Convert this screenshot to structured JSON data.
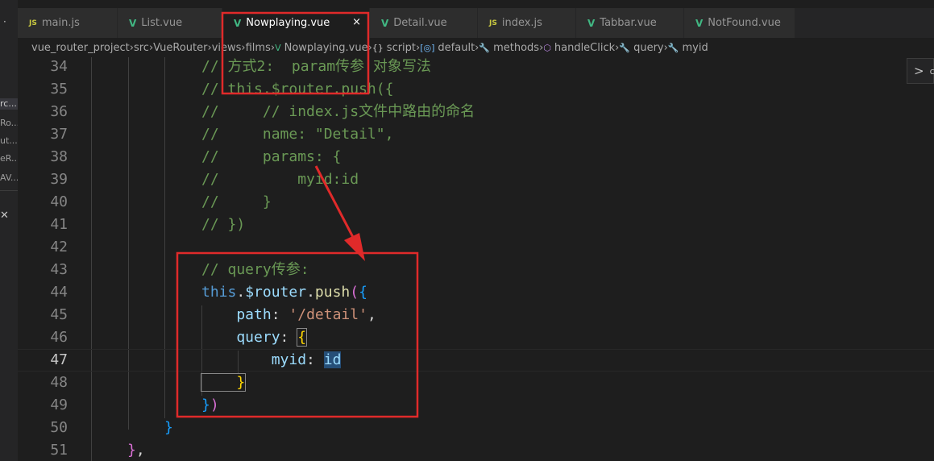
{
  "sidebar_fragment": {
    "items": [
      "rc...",
      "Ro...",
      "ut...",
      "eR...",
      "AV..."
    ]
  },
  "tabs": [
    {
      "icon": "JS",
      "label": "main.js",
      "active": false
    },
    {
      "icon": "V",
      "label": "List.vue",
      "active": false
    },
    {
      "icon": "V",
      "label": "Nowplaying.vue",
      "active": true
    },
    {
      "icon": "V",
      "label": "Detail.vue",
      "active": false
    },
    {
      "icon": "JS",
      "label": "index.js",
      "active": false
    },
    {
      "icon": "V",
      "label": "Tabbar.vue",
      "active": false
    },
    {
      "icon": "V",
      "label": "NotFound.vue",
      "active": false
    }
  ],
  "active_tab_close": "×",
  "breadcrumb": [
    "vue_router_project",
    "src",
    "VueRouter",
    "views",
    "films",
    "Nowplaying.vue",
    "script",
    "default",
    "methods",
    "handleClick",
    "query",
    "myid"
  ],
  "breadcrumb_icons": {
    "script": "{}",
    "default": "[◎]"
  },
  "editor": {
    "current_line": 47,
    "lines": [
      {
        "n": "34",
        "t": [
          [
            "c",
            "// 方式2:  param传参 对象写法"
          ]
        ]
      },
      {
        "n": "35",
        "t": [
          [
            "c",
            "// this.$router.push({"
          ]
        ]
      },
      {
        "n": "36",
        "t": [
          [
            "c",
            "//     // index.js文件中路由的命名"
          ]
        ]
      },
      {
        "n": "37",
        "t": [
          [
            "c",
            "//     name: \"Detail\","
          ]
        ]
      },
      {
        "n": "38",
        "t": [
          [
            "c",
            "//     params: {"
          ]
        ]
      },
      {
        "n": "39",
        "t": [
          [
            "c",
            "//         myid:id"
          ]
        ]
      },
      {
        "n": "40",
        "t": [
          [
            "c",
            "//     }"
          ]
        ]
      },
      {
        "n": "41",
        "t": [
          [
            "c",
            "// })"
          ]
        ]
      },
      {
        "n": "42",
        "t": []
      },
      {
        "n": "43",
        "t": [
          [
            "c",
            "// query传参:"
          ]
        ]
      },
      {
        "n": "44",
        "t": [
          [
            "kw",
            "this"
          ],
          [
            "t",
            "."
          ],
          [
            "v",
            "$router"
          ],
          [
            "t",
            "."
          ],
          [
            "f",
            "push"
          ],
          [
            "b1",
            "("
          ],
          [
            "b2",
            "{"
          ]
        ]
      },
      {
        "n": "45",
        "t": [
          [
            "v",
            "    path"
          ],
          [
            "t",
            ": "
          ],
          [
            "s",
            "'/detail'"
          ],
          [
            "t",
            ","
          ]
        ]
      },
      {
        "n": "46",
        "t": [
          [
            "v",
            "    query"
          ],
          [
            "t",
            ": "
          ],
          [
            "b3",
            "{"
          ]
        ]
      },
      {
        "n": "47",
        "t": [
          [
            "v",
            "        myid"
          ],
          [
            "t",
            ": "
          ],
          [
            "sel",
            "id"
          ]
        ]
      },
      {
        "n": "48",
        "t": [
          [
            "b3",
            "    }"
          ]
        ]
      },
      {
        "n": "49",
        "t": [
          [
            "b2",
            "}"
          ],
          [
            "b1",
            ")"
          ]
        ]
      },
      {
        "n": "50",
        "t": [
          [
            "b2",
            "}"
          ]
        ]
      },
      {
        "n": "51",
        "t": [
          [
            "b1",
            "}"
          ],
          [
            "t",
            ","
          ]
        ]
      }
    ]
  },
  "fold_widget": {
    "chevron": ">",
    "clipped_text": "c"
  },
  "colors": {
    "annotation_red": "#e02a2a",
    "editor_bg": "#1e1e1e",
    "comment": "#6a9955",
    "keyword": "#569cd6",
    "variable": "#9cdcfe",
    "function": "#dcdcaa",
    "string": "#ce9178"
  }
}
